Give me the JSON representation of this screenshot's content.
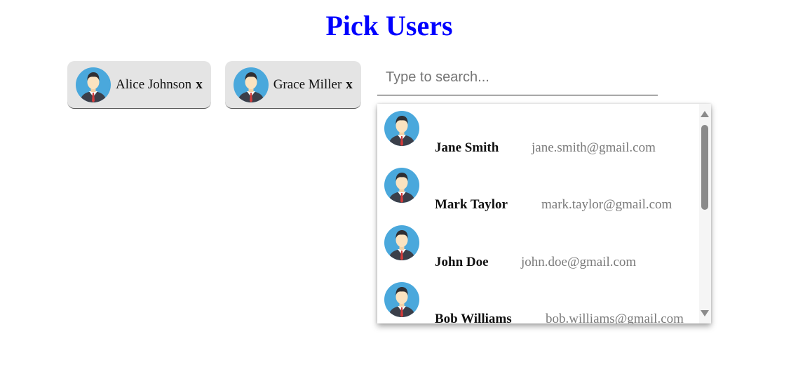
{
  "page": {
    "title": "Pick Users",
    "title_color": "#0000ff"
  },
  "selected_chips": [
    {
      "name": "Alice Johnson",
      "remove_label": "x",
      "avatar_icon": "user-avatar-icon"
    },
    {
      "name": "Grace Miller",
      "remove_label": "x",
      "avatar_icon": "user-avatar-icon"
    }
  ],
  "search": {
    "value": "",
    "placeholder": "Type to search..."
  },
  "suggestions": [
    {
      "name": "Jane Smith",
      "email": "jane.smith@gmail.com"
    },
    {
      "name": "Mark Taylor",
      "email": "mark.taylor@gmail.com"
    },
    {
      "name": "John Doe",
      "email": "john.doe@gmail.com"
    },
    {
      "name": "Bob Williams",
      "email": "bob.williams@gmail.com"
    }
  ],
  "colors": {
    "chip_background": "#e4e4e4",
    "avatar_background": "#4aa8dc",
    "email_text": "#7a7a7a"
  }
}
